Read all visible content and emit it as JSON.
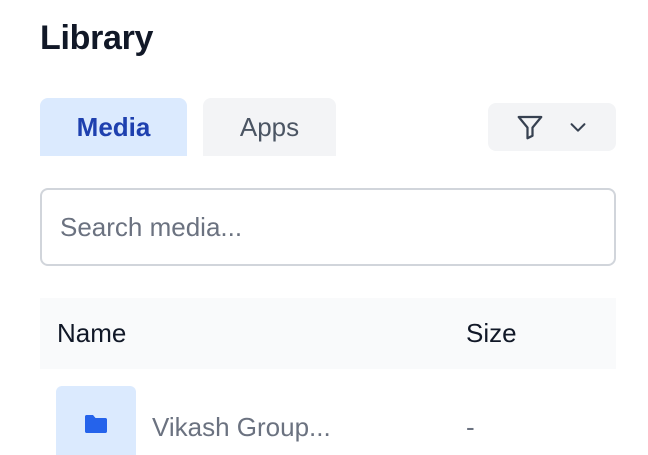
{
  "header": {
    "title": "Library"
  },
  "tabs": [
    {
      "label": "Media",
      "active": true
    },
    {
      "label": "Apps",
      "active": false
    }
  ],
  "filter": {
    "icon": "filter-icon",
    "dropdown_icon": "chevron-down-icon"
  },
  "search": {
    "placeholder": "Search media...",
    "value": ""
  },
  "table": {
    "columns": [
      "Name",
      "Size"
    ],
    "rows": [
      {
        "icon": "folder-icon",
        "name": "Vikash Group...",
        "size": "-"
      }
    ]
  },
  "colors": {
    "accent": "#1e40af",
    "accent_bg": "#dbeafe",
    "folder": "#2563eb",
    "muted_bg": "#f3f4f6",
    "muted_text": "#6b7280"
  }
}
